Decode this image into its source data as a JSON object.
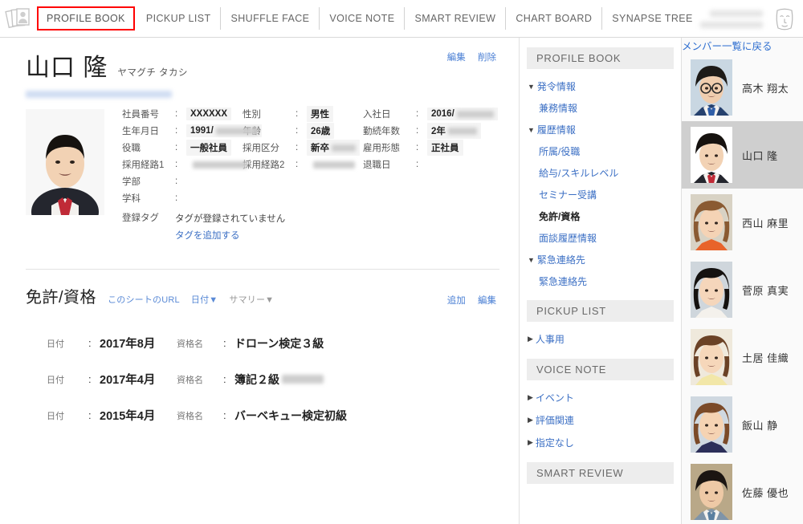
{
  "header": {
    "logo_icon": "stacked-photos-icon",
    "nav": [
      {
        "label": "PROFILE BOOK",
        "active": true
      },
      {
        "label": "PICKUP LIST",
        "active": false
      },
      {
        "label": "SHUFFLE FACE",
        "active": false
      },
      {
        "label": "VOICE NOTE",
        "active": false
      },
      {
        "label": "SMART REVIEW",
        "active": false
      },
      {
        "label": "CHART BOARD",
        "active": false
      },
      {
        "label": "SYNAPSE TREE",
        "active": false
      }
    ],
    "active_border_color": "#ff0000",
    "user_avatar_icon": "face-avatar-icon"
  },
  "profile": {
    "name": "山口 隆",
    "furigana": "ヤマグチ タカシ",
    "edit_label": "編集",
    "delete_label": "削除",
    "photo_icon": "employee-portrait",
    "fields": [
      {
        "label": "社員番号",
        "value": "XXXXXX",
        "blur": 0
      },
      {
        "label": "性別",
        "value": "男性",
        "blur": 0
      },
      {
        "label": "入社日",
        "value": "2016/",
        "blur": 46
      },
      {
        "label": "生年月日",
        "value": "1991/",
        "blur": 52
      },
      {
        "label": "年齢",
        "value": "26歳",
        "blur": 0
      },
      {
        "label": "勤続年数",
        "value": "2年",
        "blur": 36
      },
      {
        "label": "役職",
        "value": "一般社員",
        "blur": 0
      },
      {
        "label": "採用区分",
        "value": "新卒",
        "blur": 30
      },
      {
        "label": "雇用形態",
        "value": "正社員",
        "blur": 0
      },
      {
        "label": "採用経路1",
        "value": "",
        "blur": 68
      },
      {
        "label": "採用経路2",
        "value": "",
        "blur": 52
      },
      {
        "label": "退職日",
        "value": "",
        "blur": 0
      },
      {
        "label": "学部",
        "value": "",
        "blur": 0
      },
      {
        "label": "学科",
        "value": "",
        "blur": 0
      }
    ],
    "tag_label": "登録タグ",
    "tag_empty_text": "タグが登録されていません",
    "tag_add_label": "タグを追加する"
  },
  "license_section": {
    "title": "免許/資格",
    "sheet_url_label": "このシートのURL",
    "sort_label": "日付▼",
    "summary_label": "サマリー▼",
    "add_label": "追加",
    "edit_label": "編集",
    "date_label": "日付",
    "name_label": "資格名",
    "rows": [
      {
        "date": "2017年8月",
        "name": "ドローン検定３級",
        "blur": 0
      },
      {
        "date": "2017年4月",
        "name": "簿記２級",
        "blur": 52
      },
      {
        "date": "2015年4月",
        "name": "バーベキュー検定初級",
        "blur": 0
      }
    ]
  },
  "sidebar": {
    "sections": [
      {
        "title": "PROFILE BOOK",
        "items": [
          {
            "label": "発令情報",
            "level": 1,
            "marker": "▼",
            "active": false
          },
          {
            "label": "兼務情報",
            "level": 2,
            "marker": "",
            "active": false
          },
          {
            "label": "履歴情報",
            "level": 1,
            "marker": "▼",
            "active": false
          },
          {
            "label": "所属/役職",
            "level": 2,
            "marker": "",
            "active": false
          },
          {
            "label": "給与/スキルレベル",
            "level": 2,
            "marker": "",
            "active": false
          },
          {
            "label": "セミナー受講",
            "level": 2,
            "marker": "",
            "active": false
          },
          {
            "label": "免許/資格",
            "level": 2,
            "marker": "",
            "active": true
          },
          {
            "label": "面談履歴情報",
            "level": 2,
            "marker": "",
            "active": false
          },
          {
            "label": "緊急連絡先",
            "level": 1,
            "marker": "▼",
            "active": false
          },
          {
            "label": "緊急連絡先",
            "level": 2,
            "marker": "",
            "active": false
          }
        ]
      },
      {
        "title": "PICKUP LIST",
        "items": [
          {
            "label": "人事用",
            "level": 1,
            "marker": "▶",
            "active": false
          }
        ]
      },
      {
        "title": "VOICE NOTE",
        "items": [
          {
            "label": "イベント",
            "level": 1,
            "marker": "▶",
            "active": false
          },
          {
            "label": "評価関連",
            "level": 1,
            "marker": "▶",
            "active": false
          },
          {
            "label": "指定なし",
            "level": 1,
            "marker": "▶",
            "active": false
          }
        ]
      },
      {
        "title": "SMART REVIEW",
        "items": []
      }
    ]
  },
  "member_panel": {
    "back_label": "メンバー一覧に戻る",
    "members": [
      {
        "name": "高木 翔太",
        "selected": false,
        "hair": "#1d1a17",
        "skin": "#f0cdae",
        "suit": "#26416e",
        "bg": "#c9d7e2",
        "glasses": true,
        "female": false,
        "tie": "#2f5ea8"
      },
      {
        "name": "山口 隆",
        "selected": true,
        "hair": "#16120f",
        "skin": "#f2d2b4",
        "suit": "#24262e",
        "bg": "#ffffff",
        "glasses": false,
        "female": false,
        "tie": "#c02a37"
      },
      {
        "name": "西山 麻里",
        "selected": false,
        "hair": "#8a5a32",
        "skin": "#f5d3b5",
        "suit": "#e8632a",
        "bg": "#d8d2c4",
        "glasses": false,
        "female": true,
        "tie": ""
      },
      {
        "name": "菅原 真実",
        "selected": false,
        "hair": "#151210",
        "skin": "#f5d6bb",
        "suit": "#f4f1ec",
        "bg": "#cfd6dc",
        "glasses": false,
        "female": true,
        "tie": ""
      },
      {
        "name": "土居 佳織",
        "selected": false,
        "hair": "#6b4226",
        "skin": "#f6d7ba",
        "suit": "#f2e7a8",
        "bg": "#efe9dc",
        "glasses": false,
        "female": true,
        "tie": ""
      },
      {
        "name": "飯山 静",
        "selected": false,
        "hair": "#7b4a28",
        "skin": "#f5d3b3",
        "suit": "#2c2f59",
        "bg": "#cfd8e0",
        "glasses": false,
        "female": true,
        "tie": ""
      },
      {
        "name": "佐藤 優也",
        "selected": false,
        "hair": "#1b1512",
        "skin": "#eec9a6",
        "suit": "#7f94a8",
        "bg": "#b9a888",
        "glasses": false,
        "female": false,
        "tie": "#5a7fa0"
      }
    ]
  }
}
